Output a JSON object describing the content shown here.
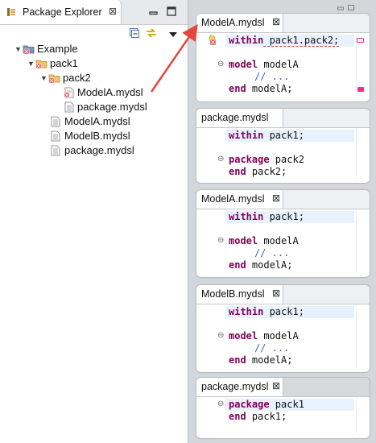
{
  "explorer": {
    "title": "Package Explorer",
    "close_glyph": "⊠",
    "tree": {
      "root": "Example",
      "pack1": "pack1",
      "pack2": "pack2",
      "pack2_modelA": "ModelA.mydsl",
      "pack2_package": "package.mydsl",
      "modelA": "ModelA.mydsl",
      "modelB": "ModelB.mydsl",
      "package": "package.mydsl"
    }
  },
  "editors": [
    {
      "tab": "ModelA.mydsl",
      "lines": {
        "l1_kw": "within",
        "l1_rest": " pack1.pack2;",
        "l2_kw": "model",
        "l2_rest": " modelA",
        "l3": "// ...",
        "l4_kw": "end",
        "l4_rest": " modelA;"
      }
    },
    {
      "tab": "package.mydsl",
      "lines": {
        "l1_kw": "within",
        "l1_rest": " pack1;",
        "l2_kw": "package",
        "l2_rest": " pack2",
        "l3_kw": "end",
        "l3_rest": " pack2;"
      }
    },
    {
      "tab": "ModelA.mydsl",
      "lines": {
        "l1_kw": "within",
        "l1_rest": " pack1;",
        "l2_kw": "model",
        "l2_rest": " modelA",
        "l3": "// ...",
        "l4_kw": "end",
        "l4_rest": " modelA;"
      }
    },
    {
      "tab": "ModelB.mydsl",
      "lines": {
        "l1_kw": "within",
        "l1_rest": " pack1;",
        "l2_kw": "model",
        "l2_rest": " modelA",
        "l3": "// ...",
        "l4_kw": "end",
        "l4_rest": " modelA;"
      }
    },
    {
      "tab": "package.mydsl",
      "lines": {
        "l1_kw": "package",
        "l1_rest": " pack1",
        "l2_kw": "end",
        "l2_rest": " pack1;"
      }
    }
  ],
  "colors": {
    "keyword": "#7f0055",
    "comment": "#3f5fbf",
    "error_marker": "#e8338c",
    "arrow": "#e5473a",
    "current_line": "#e8f2fe"
  },
  "icons": [
    "package-explorer-icon",
    "minimize-icon",
    "maximize-icon",
    "collapse-all-icon",
    "link-with-editor-icon",
    "view-menu-icon",
    "project-icon",
    "package-folder-icon",
    "file-icon",
    "error-file-icon",
    "fold-icon",
    "error-marker-icon"
  ]
}
